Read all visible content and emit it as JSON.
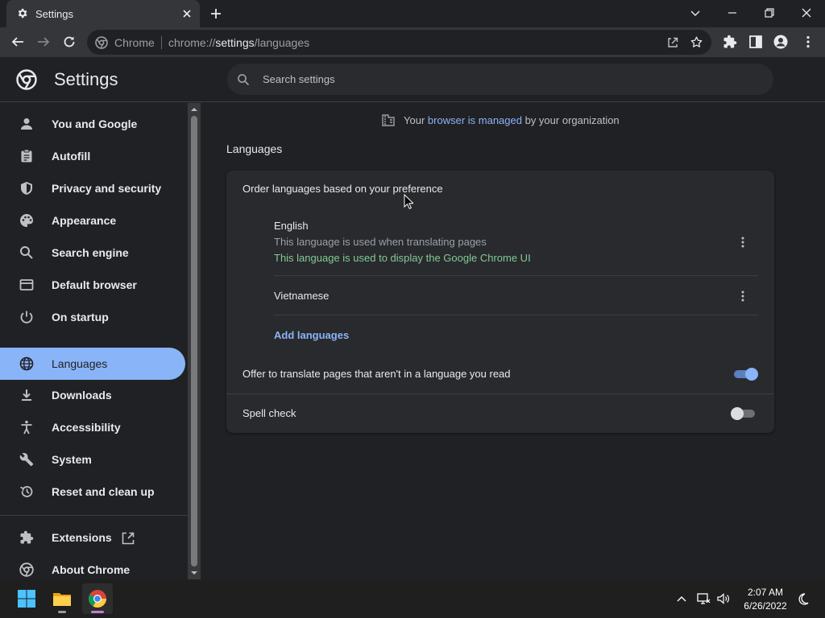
{
  "browser": {
    "tab_title": "Settings",
    "omnibox": {
      "site_name": "Chrome",
      "url_scheme": "chrome://",
      "url_host": "settings",
      "url_path": "/languages"
    }
  },
  "settings": {
    "title": "Settings",
    "search_placeholder": "Search settings"
  },
  "sidebar": {
    "items": [
      {
        "label": "You and Google",
        "icon": "person-icon"
      },
      {
        "label": "Autofill",
        "icon": "clipboard-icon"
      },
      {
        "label": "Privacy and security",
        "icon": "shield-icon"
      },
      {
        "label": "Appearance",
        "icon": "palette-icon"
      },
      {
        "label": "Search engine",
        "icon": "search-icon"
      },
      {
        "label": "Default browser",
        "icon": "browser-icon"
      },
      {
        "label": "On startup",
        "icon": "power-icon"
      },
      {
        "label": "Languages",
        "icon": "globe-icon",
        "active": true
      },
      {
        "label": "Downloads",
        "icon": "download-icon"
      },
      {
        "label": "Accessibility",
        "icon": "accessibility-icon"
      },
      {
        "label": "System",
        "icon": "wrench-icon"
      },
      {
        "label": "Reset and clean up",
        "icon": "history-icon"
      },
      {
        "label": "Extensions",
        "icon": "puzzle-icon"
      },
      {
        "label": "About Chrome",
        "icon": "chrome-icon"
      }
    ]
  },
  "managed": {
    "prefix": "Your",
    "link": "browser is managed",
    "suffix": "by your organization"
  },
  "languages": {
    "section_title": "Languages",
    "order_label": "Order languages based on your preference",
    "list": [
      {
        "name": "English",
        "translate_note": "This language is used when translating pages",
        "ui_note": "This language is used to display the Google Chrome UI"
      },
      {
        "name": "Vietnamese"
      }
    ],
    "add_languages": "Add languages",
    "offer_translate": {
      "label": "Offer to translate pages that aren't in a language you read",
      "enabled": true
    },
    "spell_check": {
      "label": "Spell check",
      "enabled": false
    }
  },
  "taskbar": {
    "time": "2:07 AM",
    "date": "6/26/2022"
  },
  "colors": {
    "accent": "#8ab4f8",
    "background": "#202124",
    "card": "#292a2d",
    "ui_language_note": "#81c995"
  }
}
